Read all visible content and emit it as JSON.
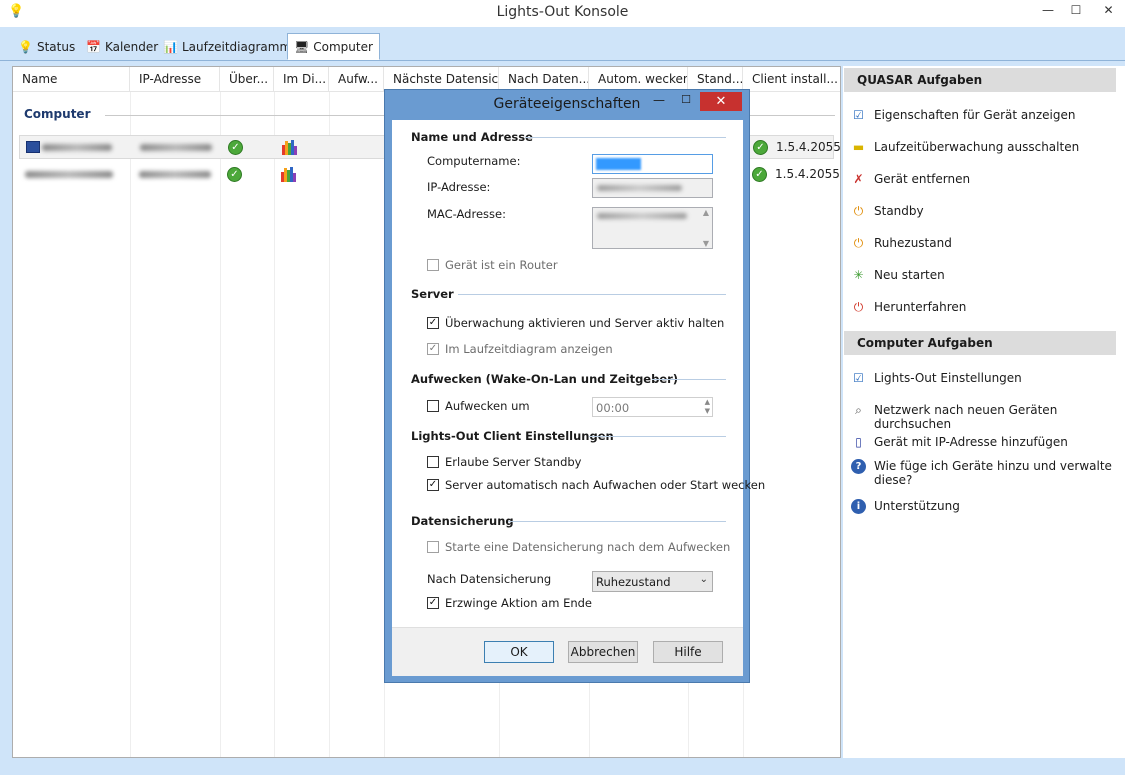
{
  "window": {
    "title": "Lights-Out Konsole",
    "min_glyph": "—",
    "max_glyph": "☐",
    "close_glyph": "✕"
  },
  "tabs": [
    {
      "label": "Status",
      "icon": "bulb-icon",
      "glyph": "💡"
    },
    {
      "label": "Kalender",
      "icon": "calendar-icon",
      "glyph": "📅"
    },
    {
      "label": "Laufzeitdiagramm",
      "icon": "chart-icon",
      "glyph": "📊"
    },
    {
      "label": "Computer",
      "icon": "computer-icon",
      "glyph": "🖥",
      "active": true
    }
  ],
  "list": {
    "columns": [
      "Name",
      "IP-Adresse",
      "Über...",
      "Im Di...",
      "Aufw...",
      "Nächste Datensic...",
      "Nach Daten...",
      "Autom. wecken",
      "Stand...",
      "Client install..."
    ],
    "group": "Computer",
    "rows": [
      {
        "version": "1.5.4.2055",
        "status_glyph": "✓"
      },
      {
        "version": "1.5.4.2055",
        "status_glyph": "✓"
      }
    ]
  },
  "tasks": {
    "quasar_header": "QUASAR Aufgaben",
    "quasar": [
      {
        "label": "Eigenschaften für Gerät anzeigen",
        "icon": "properties-icon",
        "glyph": "☑",
        "color": "#2f6fbf"
      },
      {
        "label": "Laufzeitüberwachung ausschalten",
        "icon": "monitoring-off-icon",
        "glyph": "▬",
        "color": "#d9b400"
      },
      {
        "label": "Gerät entfernen",
        "icon": "remove-icon",
        "glyph": "✗",
        "color": "#c9302c"
      },
      {
        "label": "Standby",
        "icon": "standby-icon",
        "glyph": "⏻",
        "color": "#e08e0b"
      },
      {
        "label": "Ruhezustand",
        "icon": "hibernate-icon",
        "glyph": "⏻",
        "color": "#e08e0b"
      },
      {
        "label": "Neu starten",
        "icon": "restart-icon",
        "glyph": "✳",
        "color": "#3a9a2e"
      },
      {
        "label": "Herunterfahren",
        "icon": "shutdown-icon",
        "glyph": "⏻",
        "color": "#d0392b"
      }
    ],
    "computer_header": "Computer Aufgaben",
    "computer": [
      {
        "label": "Lights-Out Einstellungen",
        "icon": "settings-icon",
        "glyph": "☑",
        "color": "#2f6fbf"
      },
      {
        "label": "Netzwerk nach neuen Geräten durchsuchen",
        "icon": "network-scan-icon",
        "glyph": "⌕",
        "color": "#555555"
      },
      {
        "label": "Gerät mit IP-Adresse hinzufügen",
        "icon": "add-device-icon",
        "glyph": "▯",
        "color": "#2d3fa0"
      },
      {
        "label": "Wie füge ich Geräte hinzu und verwalte diese?",
        "icon": "help-icon",
        "glyph": "?",
        "color": "#2f5faf"
      },
      {
        "label": "Unterstützung",
        "icon": "info-icon",
        "glyph": "i",
        "color": "#2f5faf"
      }
    ]
  },
  "dialog": {
    "title": "Geräteeigenschaften",
    "close_glyph": "✕",
    "sections": {
      "name": "Name und Adresse",
      "server": "Server",
      "wake": "Aufwecken (Wake-On-Lan und Zeitgeber)",
      "client": "Lights-Out Client Einstellungen",
      "backup": "Datensicherung"
    },
    "labels": {
      "computername": "Computername:",
      "ip": "IP-Adresse:",
      "mac": "MAC-Adresse:",
      "nach_datensicherung": "Nach Datensicherung"
    },
    "checkboxes": {
      "router": {
        "label": "Gerät ist ein Router",
        "checked": false
      },
      "monitoring": {
        "label": "Überwachung aktivieren und Server aktiv halten",
        "checked": true
      },
      "diagram": {
        "label": "Im Laufzeitdiagram anzeigen",
        "checked": true
      },
      "wake_at": {
        "label": "Aufwecken um",
        "checked": false
      },
      "allow_standby": {
        "label": "Erlaube Server Standby",
        "checked": false
      },
      "auto_wake": {
        "label": "Server automatisch nach Aufwachen oder Start wecken",
        "checked": true
      },
      "backup_start": {
        "label": "Starte eine Datensicherung  nach dem Aufwecken",
        "checked": false
      },
      "force": {
        "label": "Erzwinge Aktion am Ende",
        "checked": true
      }
    },
    "check_glyph": "✓",
    "wake_time": "00:00",
    "after_backup_selected": "Ruhezustand",
    "buttons": {
      "ok": "OK",
      "cancel": "Abbrechen",
      "help": "Hilfe"
    }
  }
}
